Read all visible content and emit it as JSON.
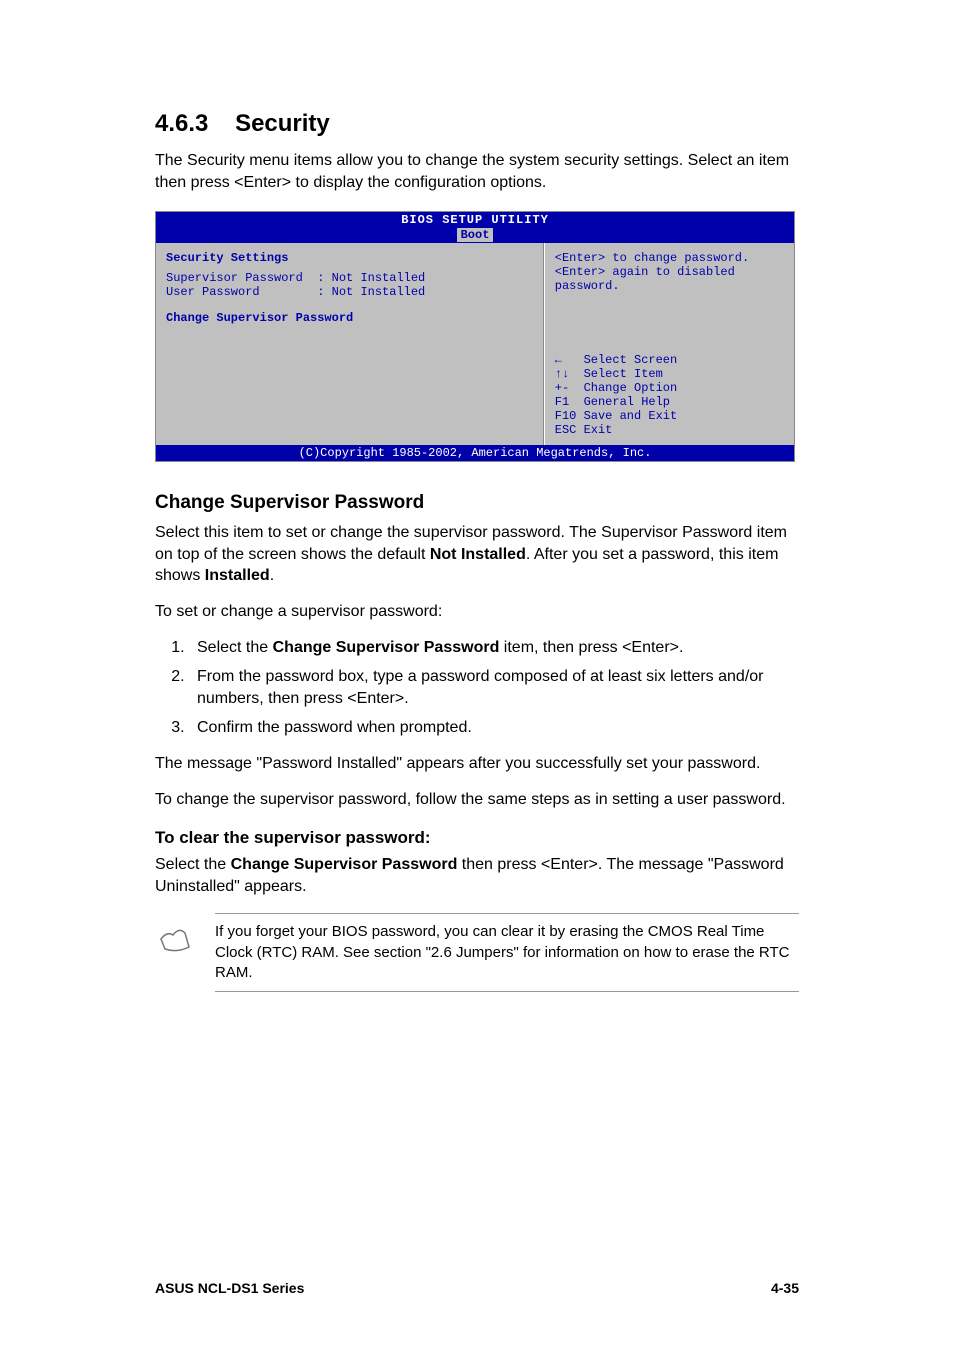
{
  "heading": {
    "number": "4.6.3",
    "title": "Security"
  },
  "intro": "The Security menu items allow you to change the system security settings. Select an item then press <Enter> to display the configuration options.",
  "bios": {
    "title": "BIOS SETUP UTILITY",
    "tab": "Boot",
    "left": {
      "heading": "Security Settings",
      "rows": [
        {
          "label": "Supervisor Password",
          "value": ": Not Installed"
        },
        {
          "label": "User Password",
          "value": ": Not Installed"
        }
      ],
      "action": "Change Supervisor Password"
    },
    "right": {
      "help": "<Enter> to change password.\n<Enter> again to disabled password.",
      "keys": [
        {
          "icon": "←",
          "text": "Select Screen"
        },
        {
          "icon": "↑↓",
          "text": "Select Item"
        },
        {
          "icon": "+-",
          "text": "Change Option"
        },
        {
          "icon": "F1",
          "text": "General Help"
        },
        {
          "icon": "F10",
          "text": "Save and Exit"
        },
        {
          "icon": "ESC",
          "text": "Exit"
        }
      ]
    },
    "footer": "(C)Copyright 1985-2002, American Megatrends, Inc."
  },
  "change_pw": {
    "heading": "Change Supervisor Password",
    "p1a": "Select this item to set or change the supervisor password. The Supervisor Password item on top of the screen shows the default ",
    "p1b": "Not Installed",
    "p1c": ". After you set a password, this item shows ",
    "p1d": "Installed",
    "p1e": ".",
    "p2": "To set or change a supervisor password:",
    "steps": {
      "s1a": "Select the ",
      "s1b": "Change Supervisor Password",
      "s1c": " item, then press <Enter>.",
      "s2": "From the password box, type a password composed of at least six letters and/or numbers, then press <Enter>.",
      "s3": "Confirm the password when prompted."
    },
    "p3": "The message \"Password Installed\" appears after you successfully set your password.",
    "p4": "To change the supervisor password, follow the same steps as in setting a user password."
  },
  "clear_pw": {
    "heading": "To clear the supervisor password:",
    "p1a": "Select the ",
    "p1b": "Change Supervisor Password",
    "p1c": " then press <Enter>. The message \"Password Uninstalled\" appears."
  },
  "note": "If you forget your BIOS password, you can clear it by erasing the CMOS Real Time Clock (RTC) RAM. See section \"2.6  Jumpers\" for information on how to erase the RTC RAM.",
  "footer": {
    "left": "ASUS NCL-DS1 Series",
    "right": "4-35"
  }
}
